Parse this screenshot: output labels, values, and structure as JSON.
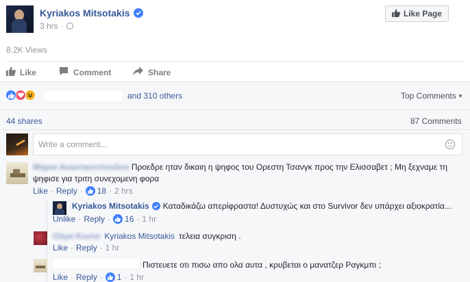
{
  "post": {
    "author": "Kyriakos Mitsotakis",
    "time": "3 hrs",
    "dot": "·",
    "like_page": "Like Page",
    "views": "8.2K Views"
  },
  "actions": {
    "like": "Like",
    "comment": "Comment",
    "share": "Share"
  },
  "reactions": {
    "others": "and 310 others",
    "top_comments": "Top Comments",
    "caret": "▾"
  },
  "stats": {
    "shares": "44 shares",
    "comments": "87 Comments"
  },
  "composer": {
    "placeholder": "Write a comment..."
  },
  "comments": [
    {
      "author": "Μαρια Αναστασοπουλου",
      "text_line1": "Προεδρε ηταν δικαιη η ψηφος του Ορεστη Τσανγκ προς την Ελισσαβετ ; Μη ξεχναμε τη",
      "text_line2": "ψηφισε για τριτη συνεχομενη φορα",
      "like": "Like",
      "reply": "Reply",
      "likes": "18",
      "time": "2 hrs",
      "replies": [
        {
          "author": "Kyriakos Mitsotakis",
          "text": "Καταδικάζω απερίφραστα! Δυστυχώς και στο Survivor δεν υπάρχει αξιοκρατία...",
          "like": "Unlike",
          "reply": "Reply",
          "likes": "16",
          "time": "1 hr"
        },
        {
          "author": "Ολγα Κουτσ",
          "mention": "Kyriakos Mitsotakis",
          "text": "τελεια συγκριση .",
          "like": "Like",
          "reply": "Reply",
          "time": "1 hr"
        },
        {
          "author": "",
          "text": "Πιστευετε οτι πισω απο ολα αυτα , κρυβεται ο μανατζερ Ραγκμπι ;",
          "like": "Like",
          "reply": "Reply",
          "likes": "1",
          "time": "1 hr"
        }
      ]
    }
  ],
  "colors": {
    "link": "#365899",
    "grey": "#90949c",
    "like_blue": "#4080ff",
    "love_red": "#f25268",
    "haha_yellow": "#f7b125"
  }
}
